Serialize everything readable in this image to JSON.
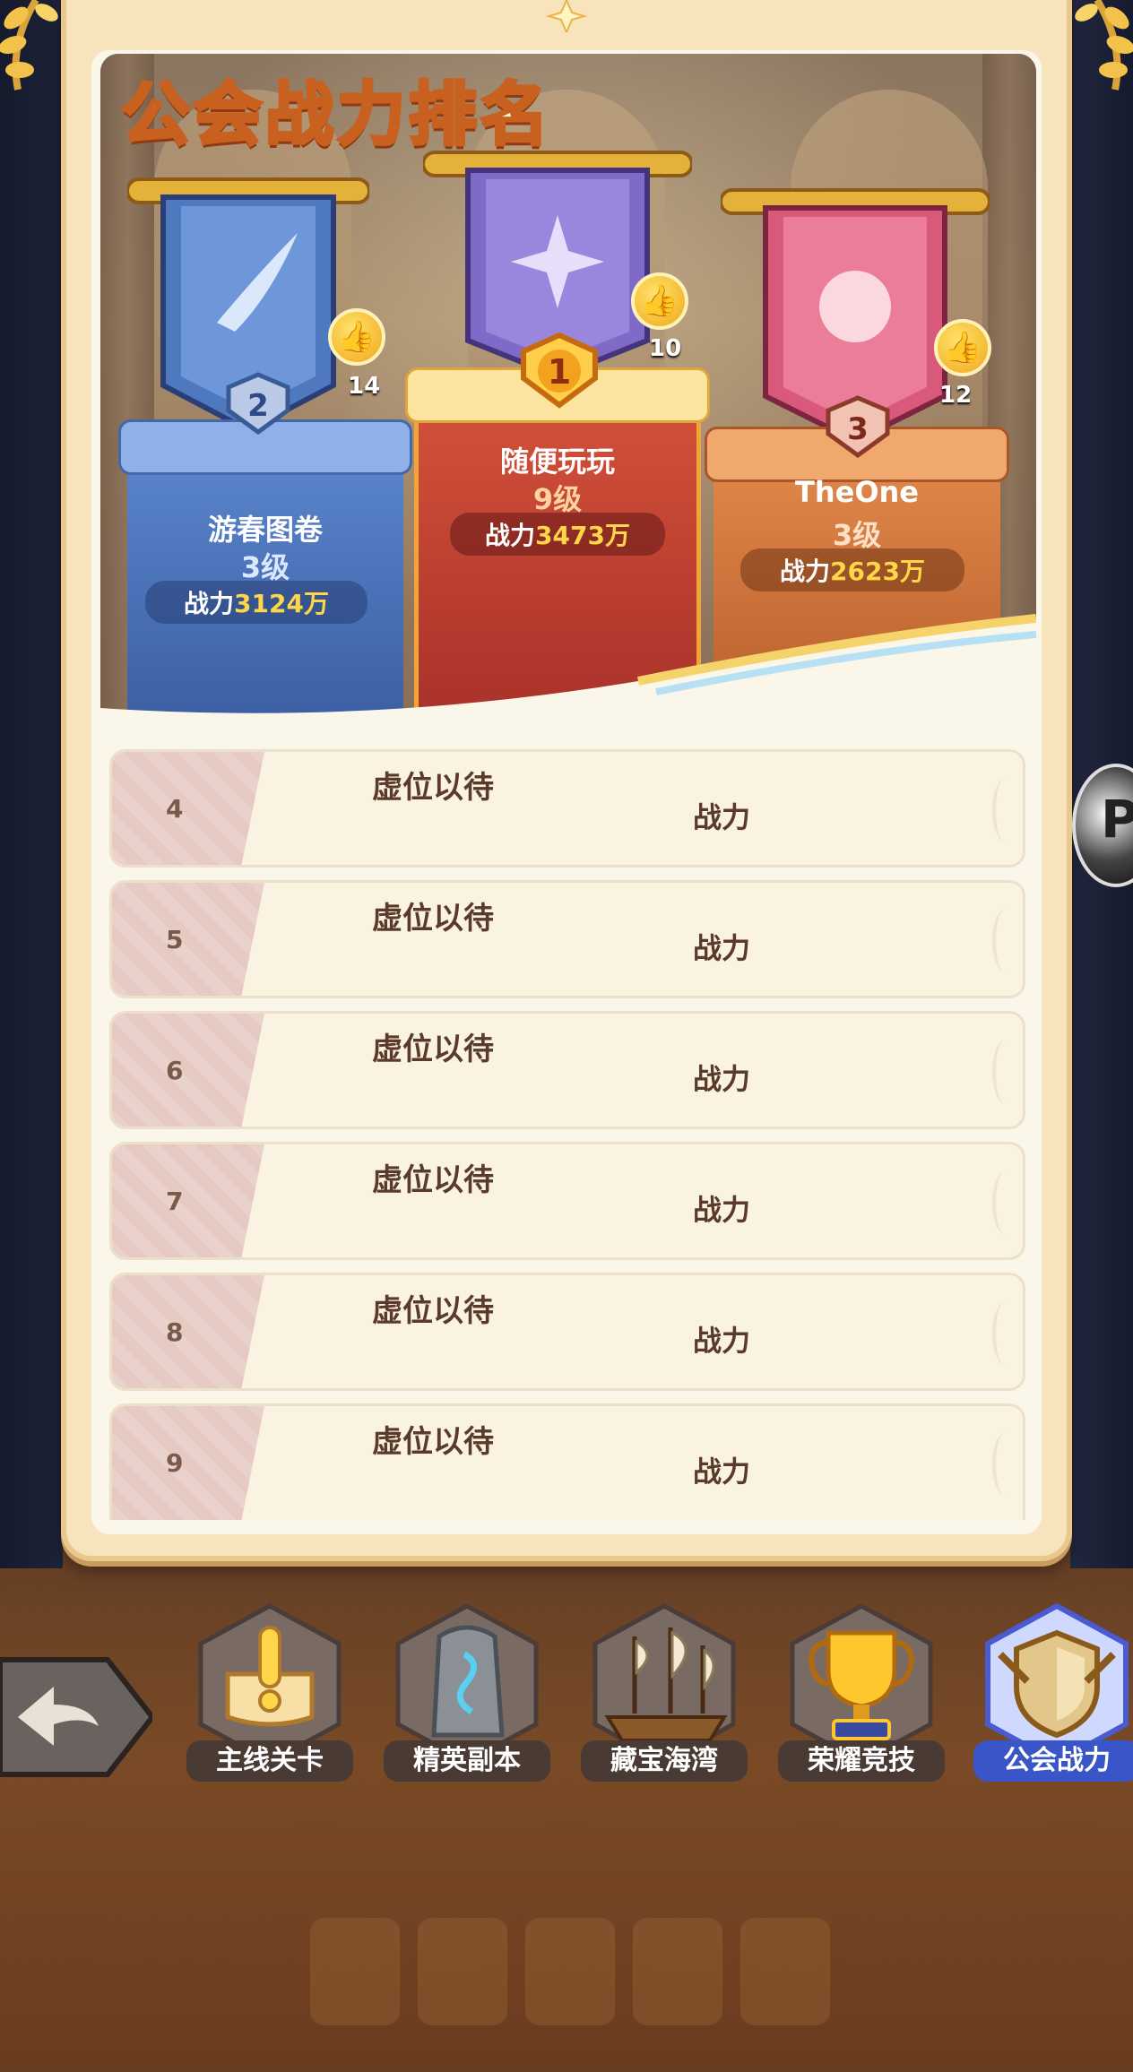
{
  "title": "公会战力排名",
  "top3": [
    {
      "rank": "1",
      "name": "随便玩玩",
      "level": "9级",
      "power_label": "战力",
      "power_value": "3473万",
      "likes": "10"
    },
    {
      "rank": "2",
      "name": "游春图卷",
      "level": "3级",
      "power_label": "战力",
      "power_value": "3124万",
      "likes": "14"
    },
    {
      "rank": "3",
      "name": "TheOne",
      "level": "3级",
      "power_label": "战力",
      "power_value": "2623万",
      "likes": "12"
    }
  ],
  "ranking_list": [
    {
      "rank": "4",
      "name": "虚位以待",
      "power_label": "战力"
    },
    {
      "rank": "5",
      "name": "虚位以待",
      "power_label": "战力"
    },
    {
      "rank": "6",
      "name": "虚位以待",
      "power_label": "战力"
    },
    {
      "rank": "7",
      "name": "虚位以待",
      "power_label": "战力"
    },
    {
      "rank": "8",
      "name": "虚位以待",
      "power_label": "战力"
    },
    {
      "rank": "9",
      "name": "虚位以待",
      "power_label": "战力"
    }
  ],
  "nav": [
    {
      "label": "主线关卡",
      "icon": "book-alert-icon",
      "active": false
    },
    {
      "label": "精英副本",
      "icon": "rune-stone-icon",
      "active": false
    },
    {
      "label": "藏宝海湾",
      "icon": "ship-icon",
      "active": false
    },
    {
      "label": "荣耀竞技",
      "icon": "trophy-icon",
      "active": false
    },
    {
      "label": "公会战力",
      "icon": "guild-shield-icon",
      "active": true
    }
  ],
  "colors": {
    "rank1": "#c2442e",
    "rank2": "#4f79bf",
    "rank3": "#d67a3c",
    "active_tab": "#3a55c8",
    "gold": "#ffd64a"
  }
}
